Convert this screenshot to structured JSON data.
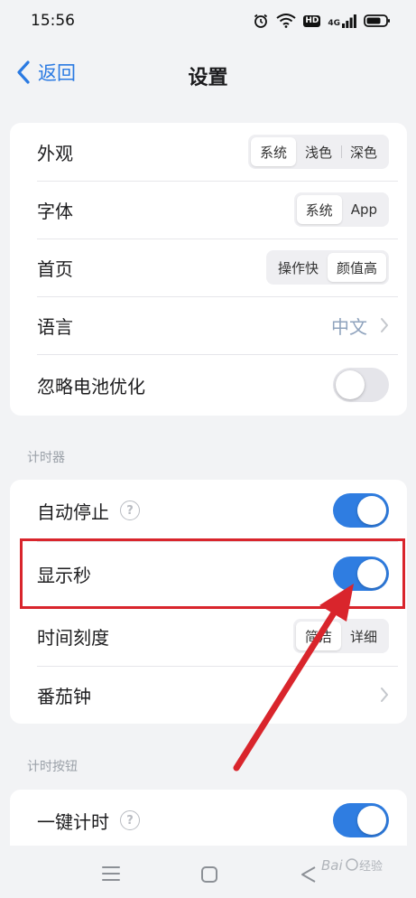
{
  "status_bar": {
    "time": "15:56",
    "network": "4G"
  },
  "header": {
    "back_label": "返回",
    "title": "设置"
  },
  "general": {
    "appearance": {
      "label": "外观",
      "options": [
        "系统",
        "浅色",
        "深色"
      ],
      "selected": "系统"
    },
    "font": {
      "label": "字体",
      "options": [
        "系统",
        "App"
      ],
      "selected": "系统"
    },
    "home": {
      "label": "首页",
      "options": [
        "操作快",
        "颜值高"
      ],
      "selected": "颜值高"
    },
    "language": {
      "label": "语言",
      "value": "中文"
    },
    "battery": {
      "label": "忽略电池优化",
      "enabled": false
    }
  },
  "timer_section": {
    "title": "计时器",
    "auto_stop": {
      "label": "自动停止",
      "enabled": true
    },
    "show_seconds": {
      "label": "显示秒",
      "enabled": true
    },
    "time_scale": {
      "label": "时间刻度",
      "options": [
        "简洁",
        "详细"
      ],
      "selected": "简洁"
    },
    "pomodoro": {
      "label": "番茄钟"
    }
  },
  "timer_button_section": {
    "title": "计时按钮",
    "one_tap": {
      "label": "一键计时",
      "enabled": true
    }
  },
  "colors": {
    "accent": "#2f7de1",
    "annotation": "#d9252c",
    "back_link": "#2a7ae2"
  }
}
